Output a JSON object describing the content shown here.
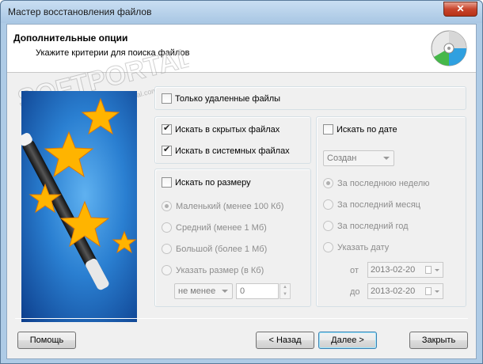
{
  "window": {
    "title": "Мастер восстановления файлов",
    "close_glyph": "✕"
  },
  "header": {
    "title": "Дополнительные опции",
    "subtitle": "Укажите критерии для поиска файлов",
    "icon": "disc-icon"
  },
  "watermark": {
    "text": "SOFTPORTAL",
    "url": "www.softportal.com"
  },
  "options": {
    "only_deleted": {
      "label": "Только удаленные файлы",
      "checked": false
    },
    "search_hidden": {
      "label": "Искать в скрытых файлах",
      "checked": true
    },
    "search_system": {
      "label": "Искать в системных файлах",
      "checked": true
    },
    "search_by_size": {
      "label": "Искать по размеру",
      "checked": false,
      "choices": [
        {
          "label": "Маленький (менее 100 Кб)",
          "selected": true
        },
        {
          "label": "Средний (менее 1 Мб)",
          "selected": false
        },
        {
          "label": "Большой (более 1 Мб)",
          "selected": false
        },
        {
          "label": "Указать размер (в Кб)",
          "selected": false
        }
      ],
      "comparison": "не менее",
      "value": "0"
    },
    "search_by_date": {
      "label": "Искать по дате",
      "checked": false,
      "date_type": "Создан",
      "choices": [
        {
          "label": "За последнюю неделю",
          "selected": true
        },
        {
          "label": "За последний месяц",
          "selected": false
        },
        {
          "label": "За последний год",
          "selected": false
        },
        {
          "label": "Указать дату",
          "selected": false
        }
      ],
      "from_label": "от",
      "from_value": "2013-02-20",
      "to_label": "до",
      "to_value": "2013-02-20"
    }
  },
  "buttons": {
    "help": "Помощь",
    "back": "< Назад",
    "next": "Далее >",
    "close": "Закрыть"
  }
}
